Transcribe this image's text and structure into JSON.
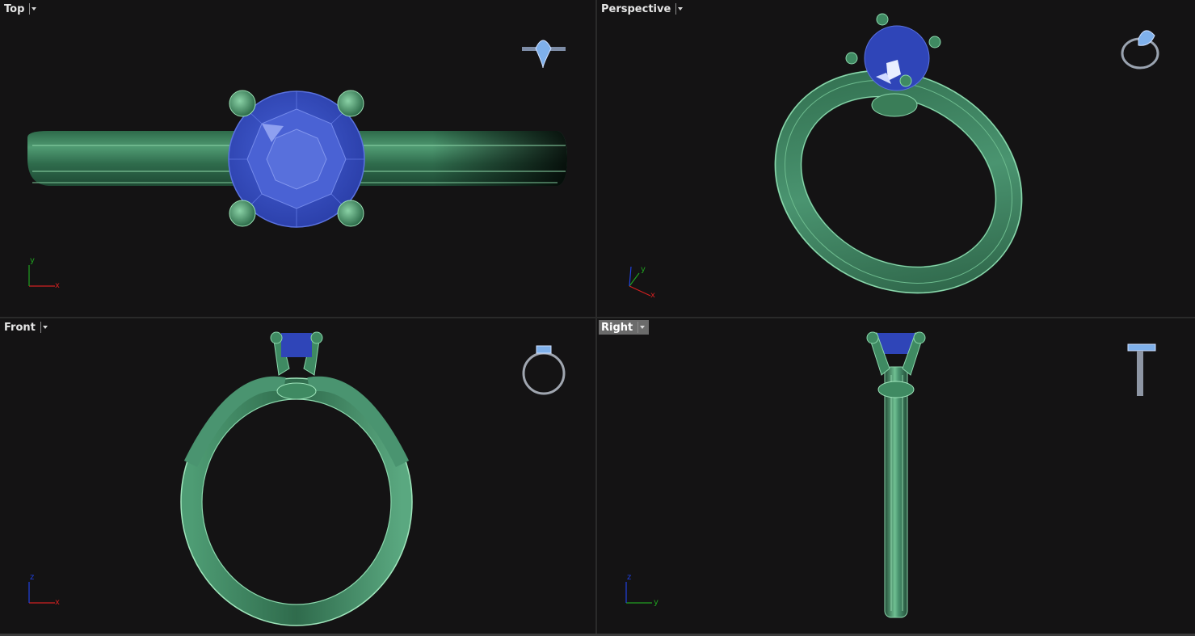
{
  "viewports": {
    "top": {
      "label": "Top",
      "axes": {
        "h": "x",
        "v": "y"
      }
    },
    "perspective": {
      "label": "Perspective",
      "axes": {
        "a": "x",
        "b": "y"
      }
    },
    "front": {
      "label": "Front",
      "axes": {
        "h": "x",
        "v": "z"
      }
    },
    "right": {
      "label": "Right",
      "axes": {
        "h": "y",
        "v": "z"
      },
      "active": true
    }
  },
  "colors": {
    "viewport_bg": "#141314",
    "metal": "#3f8a62",
    "metal_light": "#7fd0a0",
    "gem": "#2f45b8",
    "gem_light": "#6e84e6",
    "axis_x": "#d02020",
    "axis_y": "#20a020",
    "axis_z": "#2040e0"
  },
  "icons": [
    "dropdown-arrow-icon",
    "ring-thumbnail-icon",
    "axis-gizmo-icon"
  ]
}
